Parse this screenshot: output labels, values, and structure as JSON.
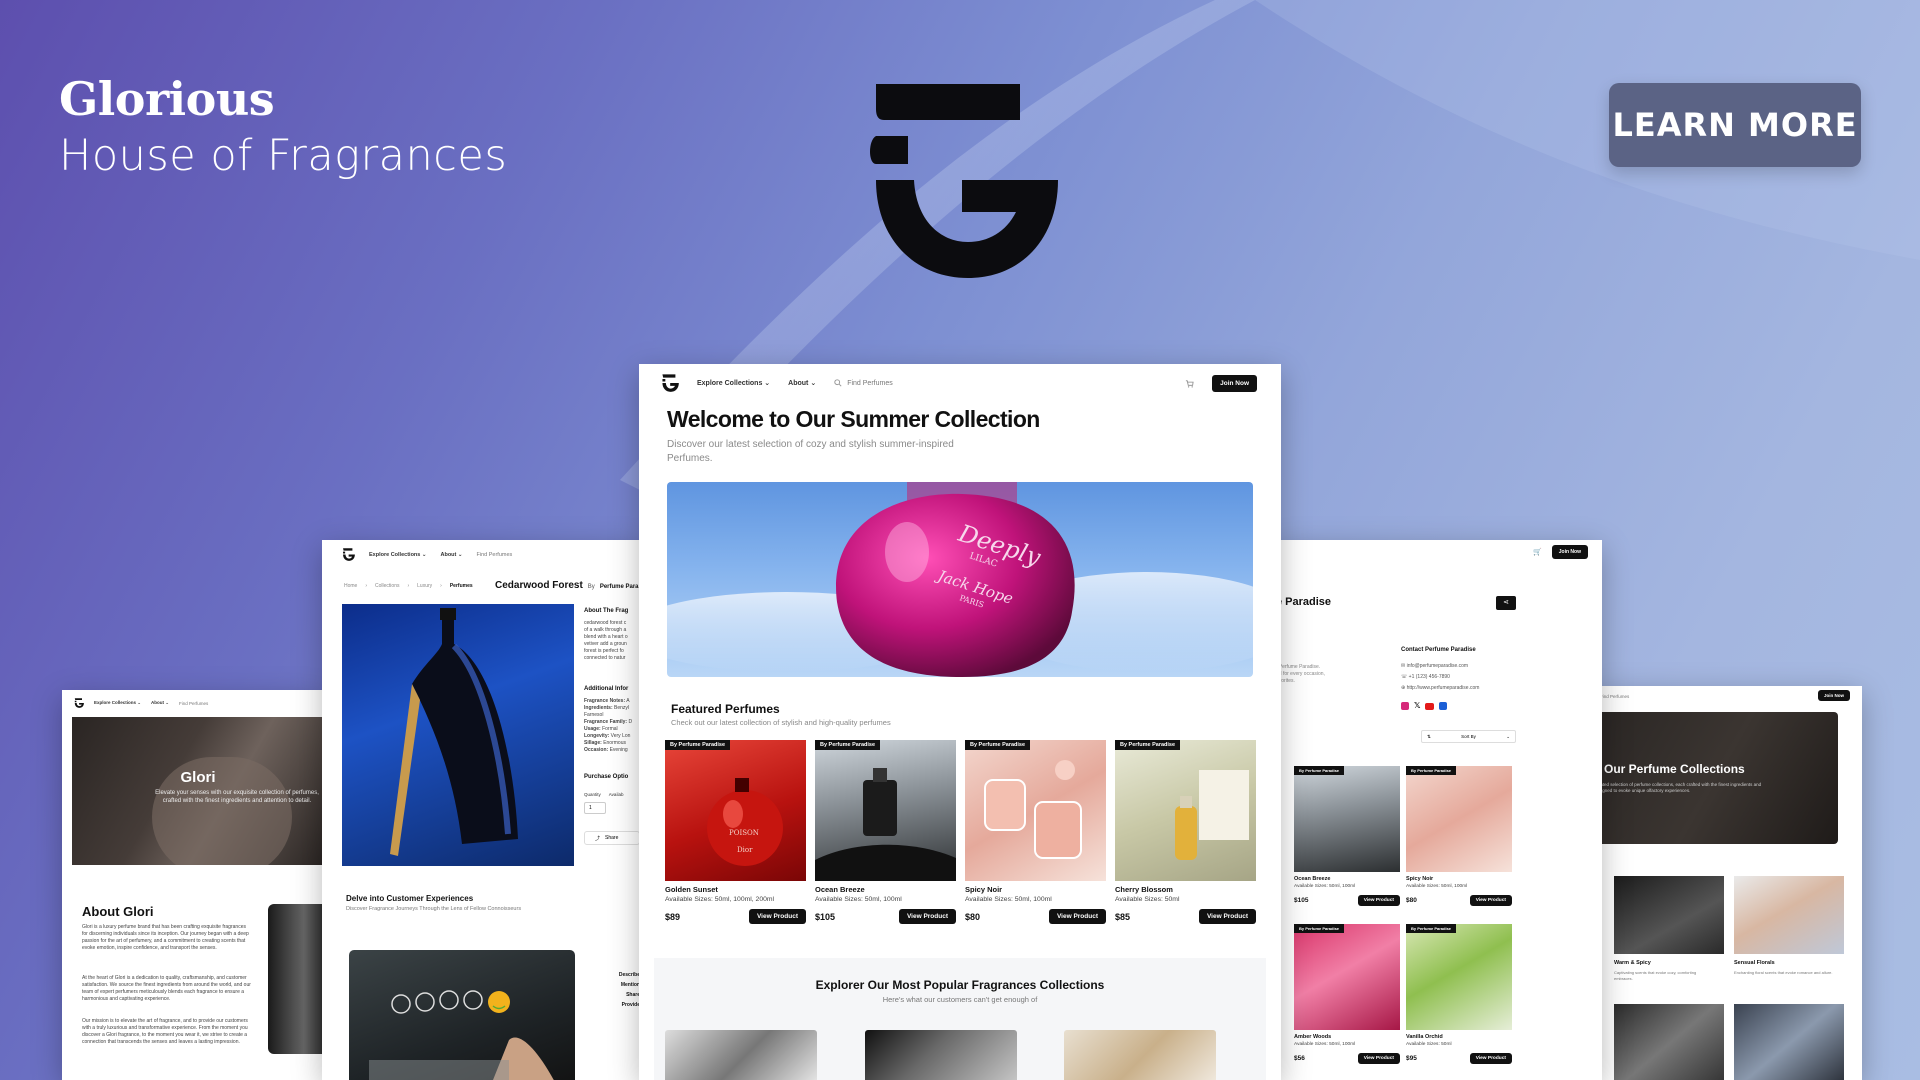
{
  "brand": {
    "name": "Glorious",
    "tagline": "House of Fragrances"
  },
  "cta": {
    "learn_more": "LEARN MORE"
  },
  "nav": {
    "explore": "Explore Collections ⌄",
    "about": "About ⌄",
    "search_placeholder": "Find Perfumes",
    "join": "Join Now"
  },
  "main": {
    "title": "Welcome to Our Summer Collection",
    "subtitle": "Discover our latest selection of cozy and stylish summer-inspired Perfumes.",
    "hero_bottle": {
      "line1": "Deeply",
      "line2": "LILAC",
      "line3": "Jack Hope",
      "line4": "PARIS"
    },
    "featured_title": "Featured Perfumes",
    "featured_subtitle": "Check out our latest collection of stylish and high-quality perfumes",
    "products": [
      {
        "tag": "By Perfume Paradise",
        "name": "Golden Sunset",
        "sizes": "Available Sizes: 50ml, 100ml, 200ml",
        "price": "$89",
        "button": "View Product"
      },
      {
        "tag": "By Perfume Paradise",
        "name": "Ocean Breeze",
        "sizes": "Available Sizes: 50ml, 100ml",
        "price": "$105",
        "button": "View Product"
      },
      {
        "tag": "By Perfume Paradise",
        "name": "Spicy Noir",
        "sizes": "Available Sizes: 50ml, 100ml",
        "price": "$80",
        "button": "View Product"
      },
      {
        "tag": "By Perfume Paradise",
        "name": "Cherry Blossom",
        "sizes": "Available Sizes: 50ml",
        "price": "$85",
        "button": "View Product"
      }
    ],
    "popular_title": "Explorer Our Most Popular Fragrances Collections",
    "popular_subtitle": "Here's what our customers can't get enough of",
    "poison_label": "POISON",
    "dior_label": "Dior"
  },
  "left_mid": {
    "breadcrumb": [
      "Home",
      "Collections",
      "Luxury",
      "Perfumes"
    ],
    "product_title": "Cedarwood Forest",
    "by": "By",
    "brand": "Perfume Para",
    "about_head": "About The Frag",
    "about_lines": [
      "cedarwood forest c",
      "of a walk through a",
      "blend with a heart o",
      "vetiver add a groun",
      "forest is perfect fo",
      "connected to natur"
    ],
    "additional_head": "Additional Infor",
    "specs": [
      {
        "k": "Fragrance Notes:",
        "v": "A"
      },
      {
        "k": "Ingredients:",
        "v": "Benzyl"
      },
      {
        "k": "",
        "v": "Farnesol"
      },
      {
        "k": "Fragrance Family:",
        "v": "D"
      },
      {
        "k": "Usage:",
        "v": "Formal"
      },
      {
        "k": "Longevity:",
        "v": "Very Lon"
      },
      {
        "k": "Sillage:",
        "v": "Enormous"
      },
      {
        "k": "Occasion:",
        "v": "Evening"
      }
    ],
    "purchase_head": "Purchase Optio",
    "quantity_label": "Quantity",
    "avail_label": "Availab",
    "qty_value": "1",
    "share": "Share",
    "exp_title": "Delve into Customer Experiences",
    "exp_sub": "Discover Fragrance Journeys Through the Lens of Fellow Connoisseurs",
    "side_words": [
      "Describe",
      "Mention",
      "Share",
      "Provide"
    ]
  },
  "left_far": {
    "hero_title": "Glori",
    "hero_text": "Elevate your senses with our exquisite collection of perfumes, crafted with the finest ingredients and attention to detail.",
    "about_title": "About Glori",
    "about_p1": "Glori is a luxury perfume brand that has been crafting exquisite fragrances for discerning individuals since its inception. Our journey began with a deep passion for the art of perfumery, and a commitment to creating scents that evoke emotion, inspire confidence, and transport the senses.",
    "about_p2": "At the heart of Glori is a dedication to quality, craftsmanship, and customer satisfaction. We source the finest ingredients from around the world, and our team of expert perfumers meticulously blends each fragrance to ensure a harmonious and captivating experience.",
    "about_p3": "Our mission is to elevate the art of fragrance, and to provide our customers with a truly luxurious and transformative experience. From the moment you discover a Glori fragrance, to the moment you wear it, we strive to create a connection that transcends the senses and leaves a lasting impression."
  },
  "right_mid": {
    "store": "e Paradise",
    "contact_head": "Contact Perfume Paradise",
    "email": "info@perfumeparadise.com",
    "phone": "+1 (123) 456-7890",
    "site": "http://www.perfumeparadise.com",
    "blurb": [
      "t Perfume Paradise.",
      "ed for every occasion,",
      "avorites."
    ],
    "sort": "Sort By",
    "cards": [
      {
        "tag": "By Perfume Paradise",
        "name": "Ocean Breeze",
        "sizes": "Available Sizes: 50ml, 100ml",
        "price": "$105",
        "button": "View Product"
      },
      {
        "tag": "By Perfume Paradise",
        "name": "Spicy Noir",
        "sizes": "Available Sizes: 50ml, 100ml",
        "price": "$80",
        "button": "View Product"
      },
      {
        "tag": "By Perfume Paradise",
        "name": "Amber Woods",
        "sizes": "Available Sizes: 50ml, 100ml",
        "price": "$56",
        "button": "View Product"
      },
      {
        "tag": "By Perfume Paradise",
        "name": "Vanilla Orchid",
        "sizes": "Available Sizes: 50ml",
        "price": "$95",
        "button": "View Product"
      }
    ]
  },
  "right_far": {
    "banner_title": "e Our Perfume Collections",
    "banner_text": "curated selection of perfume collections, each crafted with the finest ingredients and designed to evoke unique olfactory experiences.",
    "nav_text": "Find Perfumes",
    "items": [
      {
        "name": "Warm & Spicy",
        "desc": "Captivating scents that evoke cozy, comforting embraces."
      },
      {
        "name": "Sensual Florals",
        "desc": "Enchanting floral scents that evoke romance and allure."
      }
    ]
  }
}
